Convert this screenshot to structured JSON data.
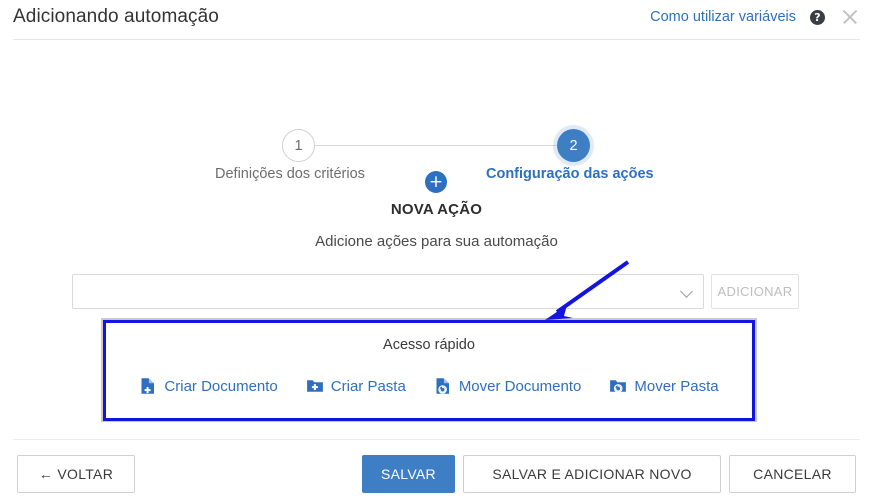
{
  "header": {
    "title": "Adicionando automação",
    "help_link": "Como utilizar variáveis",
    "help_icon_glyph": "?",
    "help_icon_name": "question-mark-icon",
    "close_icon_name": "close-icon"
  },
  "stepper": {
    "steps": [
      {
        "number": "1",
        "label": "Definições dos critérios",
        "active": false
      },
      {
        "number": "2",
        "label": "Configuração das ações",
        "active": true
      }
    ]
  },
  "new_action": {
    "plus_glyph": "+",
    "title": "NOVA AÇÃO",
    "subtitle": "Adicione ações para sua automação"
  },
  "action_select": {
    "value": "",
    "placeholder": "",
    "caret_icon": "chevron-down-icon",
    "add_label": "ADICIONAR",
    "add_enabled": false
  },
  "quick_access": {
    "title": "Acesso rápido",
    "items": [
      {
        "label": "Criar Documento",
        "icon": "document-plus-icon"
      },
      {
        "label": "Criar Pasta",
        "icon": "folder-plus-icon"
      },
      {
        "label": "Mover Documento",
        "icon": "document-move-icon"
      },
      {
        "label": "Mover Pasta",
        "icon": "folder-move-icon"
      }
    ]
  },
  "footer": {
    "back_label": "← VOLTAR",
    "save_label": "SALVAR",
    "save_add_label": "SALVAR E ADICIONAR NOVO",
    "cancel_label": "CANCELAR"
  },
  "annotations": {
    "highlight_box_color": "#1414e0",
    "arrow_color": "#1414e0"
  },
  "colors": {
    "accent_blue": "#2f6fc0",
    "primary_button": "#3d7ec4",
    "icon_blue": "#2f6fc0",
    "annotation": "#1414e0"
  }
}
